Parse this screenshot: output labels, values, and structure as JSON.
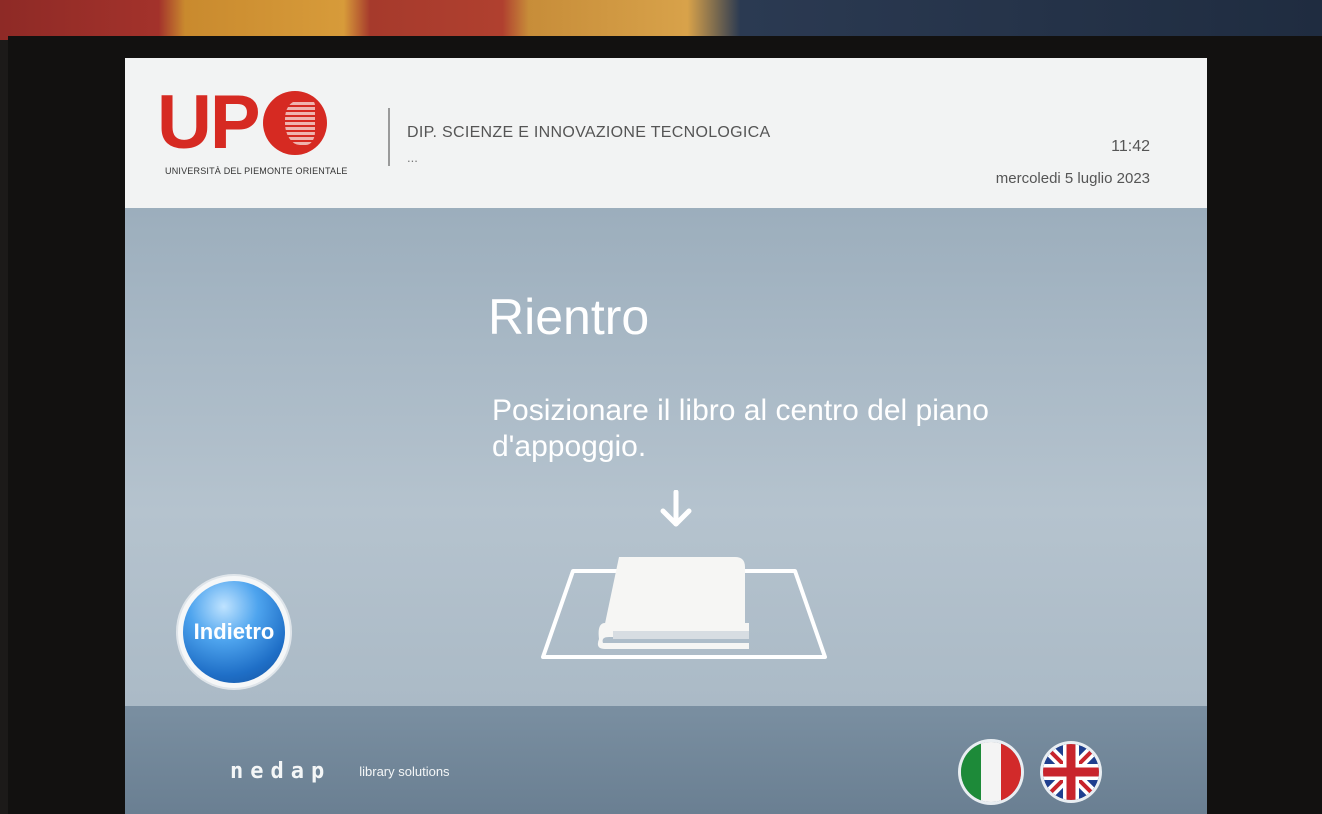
{
  "header": {
    "logo_letters": "UP",
    "logo_subtitle": "UNIVERSITÀ DEL PIEMONTE ORIENTALE",
    "department": "DIP. SCIENZE E INNOVAZIONE TECNOLOGICA",
    "department_sub": "...",
    "time": "11:42",
    "date": "mercoledi 5 luglio 2023"
  },
  "main": {
    "title": "Rientro",
    "instruction": "Posizionare il libro al centro del piano d'appoggio.",
    "icons": [
      "down-arrow-icon",
      "book-on-pad-icon"
    ]
  },
  "back_button": {
    "label": "Indietro"
  },
  "footer": {
    "brand": "nedap",
    "brand_tagline": "library solutions",
    "languages": [
      "italian-flag-icon",
      "uk-flag-icon"
    ]
  },
  "colors": {
    "screen_bg": "#a9b9c6",
    "header_bg": "#f2f3f3",
    "logo_red": "#d62a22",
    "button_blue": "#1f6fc7",
    "footer_bg": "#6a7f92"
  }
}
